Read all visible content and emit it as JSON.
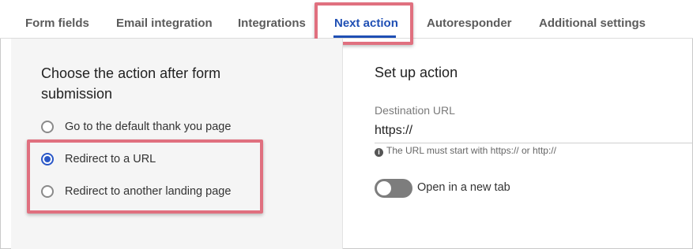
{
  "tabs": [
    {
      "label": "Form fields"
    },
    {
      "label": "Email integration"
    },
    {
      "label": "Integrations"
    },
    {
      "label": "Next action",
      "active": true
    },
    {
      "label": "Autoresponder"
    },
    {
      "label": "Additional settings"
    }
  ],
  "next_action": {
    "title": "Choose the action after form submission",
    "options": [
      {
        "label": "Go to the default thank you page",
        "selected": false
      },
      {
        "label": "Redirect to a URL",
        "selected": true
      },
      {
        "label": "Redirect to another landing page",
        "selected": false
      }
    ]
  },
  "setup": {
    "title": "Set up action",
    "destination_label": "Destination URL",
    "destination_value": "https://",
    "hint": "The URL must start with https:// or http://",
    "info_icon": "i",
    "new_tab_label": "Open in a new tab",
    "new_tab_enabled": false
  },
  "colors": {
    "accent": "#1f4fb4",
    "highlight": "#e0707f",
    "toggle_off": "#7d7d7d"
  }
}
